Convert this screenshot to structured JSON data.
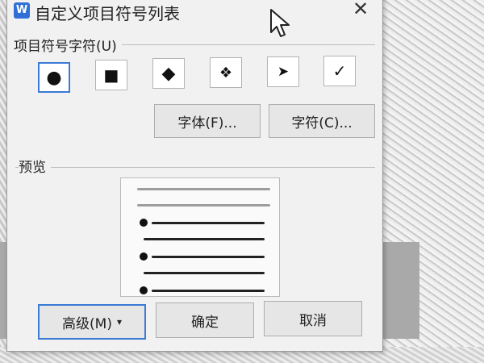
{
  "dialog": {
    "title": "自定义项目符号列表",
    "app_icon": "wps-writer-icon",
    "close_glyph": "✕"
  },
  "bullet_section": {
    "label": "项目符号字符(U)",
    "bullets": [
      {
        "glyph": "●",
        "icon": "filled-circle-bullet-icon",
        "selected": true
      },
      {
        "glyph": "■",
        "icon": "filled-square-bullet-icon",
        "selected": false
      },
      {
        "glyph": "◆",
        "icon": "diamond-bullet-icon",
        "selected": false
      },
      {
        "glyph": "❖",
        "icon": "four-diamond-bullet-icon",
        "selected": false
      },
      {
        "glyph": "➤",
        "icon": "arrowhead-bullet-icon",
        "selected": false
      },
      {
        "glyph": "✓",
        "icon": "checkmark-bullet-icon",
        "selected": false
      }
    ],
    "font_button": "字体(F)...",
    "char_button": "字符(C)..."
  },
  "preview_section": {
    "label": "预览"
  },
  "footer": {
    "advanced_button": "高级(M)",
    "advanced_arrow": "▾",
    "ok_button": "确定",
    "cancel_button": "取消"
  },
  "colors": {
    "accent": "#3a7bd5",
    "dialog_bg": "#f1f1f1"
  }
}
